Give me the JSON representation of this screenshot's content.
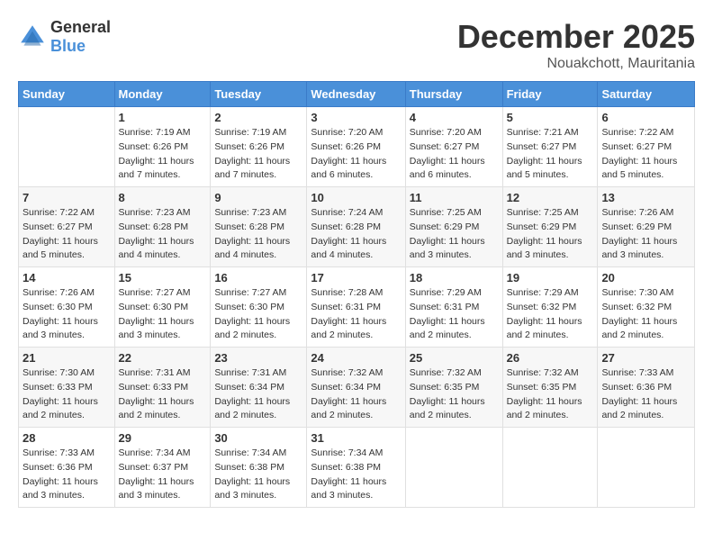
{
  "header": {
    "logo_general": "General",
    "logo_blue": "Blue",
    "month": "December 2025",
    "location": "Nouakchott, Mauritania"
  },
  "weekdays": [
    "Sunday",
    "Monday",
    "Tuesday",
    "Wednesday",
    "Thursday",
    "Friday",
    "Saturday"
  ],
  "weeks": [
    [
      {
        "day": "",
        "info": ""
      },
      {
        "day": "1",
        "info": "Sunrise: 7:19 AM\nSunset: 6:26 PM\nDaylight: 11 hours\nand 7 minutes."
      },
      {
        "day": "2",
        "info": "Sunrise: 7:19 AM\nSunset: 6:26 PM\nDaylight: 11 hours\nand 7 minutes."
      },
      {
        "day": "3",
        "info": "Sunrise: 7:20 AM\nSunset: 6:26 PM\nDaylight: 11 hours\nand 6 minutes."
      },
      {
        "day": "4",
        "info": "Sunrise: 7:20 AM\nSunset: 6:27 PM\nDaylight: 11 hours\nand 6 minutes."
      },
      {
        "day": "5",
        "info": "Sunrise: 7:21 AM\nSunset: 6:27 PM\nDaylight: 11 hours\nand 5 minutes."
      },
      {
        "day": "6",
        "info": "Sunrise: 7:22 AM\nSunset: 6:27 PM\nDaylight: 11 hours\nand 5 minutes."
      }
    ],
    [
      {
        "day": "7",
        "info": "Sunrise: 7:22 AM\nSunset: 6:27 PM\nDaylight: 11 hours\nand 5 minutes."
      },
      {
        "day": "8",
        "info": "Sunrise: 7:23 AM\nSunset: 6:28 PM\nDaylight: 11 hours\nand 4 minutes."
      },
      {
        "day": "9",
        "info": "Sunrise: 7:23 AM\nSunset: 6:28 PM\nDaylight: 11 hours\nand 4 minutes."
      },
      {
        "day": "10",
        "info": "Sunrise: 7:24 AM\nSunset: 6:28 PM\nDaylight: 11 hours\nand 4 minutes."
      },
      {
        "day": "11",
        "info": "Sunrise: 7:25 AM\nSunset: 6:29 PM\nDaylight: 11 hours\nand 3 minutes."
      },
      {
        "day": "12",
        "info": "Sunrise: 7:25 AM\nSunset: 6:29 PM\nDaylight: 11 hours\nand 3 minutes."
      },
      {
        "day": "13",
        "info": "Sunrise: 7:26 AM\nSunset: 6:29 PM\nDaylight: 11 hours\nand 3 minutes."
      }
    ],
    [
      {
        "day": "14",
        "info": "Sunrise: 7:26 AM\nSunset: 6:30 PM\nDaylight: 11 hours\nand 3 minutes."
      },
      {
        "day": "15",
        "info": "Sunrise: 7:27 AM\nSunset: 6:30 PM\nDaylight: 11 hours\nand 3 minutes."
      },
      {
        "day": "16",
        "info": "Sunrise: 7:27 AM\nSunset: 6:30 PM\nDaylight: 11 hours\nand 2 minutes."
      },
      {
        "day": "17",
        "info": "Sunrise: 7:28 AM\nSunset: 6:31 PM\nDaylight: 11 hours\nand 2 minutes."
      },
      {
        "day": "18",
        "info": "Sunrise: 7:29 AM\nSunset: 6:31 PM\nDaylight: 11 hours\nand 2 minutes."
      },
      {
        "day": "19",
        "info": "Sunrise: 7:29 AM\nSunset: 6:32 PM\nDaylight: 11 hours\nand 2 minutes."
      },
      {
        "day": "20",
        "info": "Sunrise: 7:30 AM\nSunset: 6:32 PM\nDaylight: 11 hours\nand 2 minutes."
      }
    ],
    [
      {
        "day": "21",
        "info": "Sunrise: 7:30 AM\nSunset: 6:33 PM\nDaylight: 11 hours\nand 2 minutes."
      },
      {
        "day": "22",
        "info": "Sunrise: 7:31 AM\nSunset: 6:33 PM\nDaylight: 11 hours\nand 2 minutes."
      },
      {
        "day": "23",
        "info": "Sunrise: 7:31 AM\nSunset: 6:34 PM\nDaylight: 11 hours\nand 2 minutes."
      },
      {
        "day": "24",
        "info": "Sunrise: 7:32 AM\nSunset: 6:34 PM\nDaylight: 11 hours\nand 2 minutes."
      },
      {
        "day": "25",
        "info": "Sunrise: 7:32 AM\nSunset: 6:35 PM\nDaylight: 11 hours\nand 2 minutes."
      },
      {
        "day": "26",
        "info": "Sunrise: 7:32 AM\nSunset: 6:35 PM\nDaylight: 11 hours\nand 2 minutes."
      },
      {
        "day": "27",
        "info": "Sunrise: 7:33 AM\nSunset: 6:36 PM\nDaylight: 11 hours\nand 2 minutes."
      }
    ],
    [
      {
        "day": "28",
        "info": "Sunrise: 7:33 AM\nSunset: 6:36 PM\nDaylight: 11 hours\nand 3 minutes."
      },
      {
        "day": "29",
        "info": "Sunrise: 7:34 AM\nSunset: 6:37 PM\nDaylight: 11 hours\nand 3 minutes."
      },
      {
        "day": "30",
        "info": "Sunrise: 7:34 AM\nSunset: 6:38 PM\nDaylight: 11 hours\nand 3 minutes."
      },
      {
        "day": "31",
        "info": "Sunrise: 7:34 AM\nSunset: 6:38 PM\nDaylight: 11 hours\nand 3 minutes."
      },
      {
        "day": "",
        "info": ""
      },
      {
        "day": "",
        "info": ""
      },
      {
        "day": "",
        "info": ""
      }
    ]
  ]
}
